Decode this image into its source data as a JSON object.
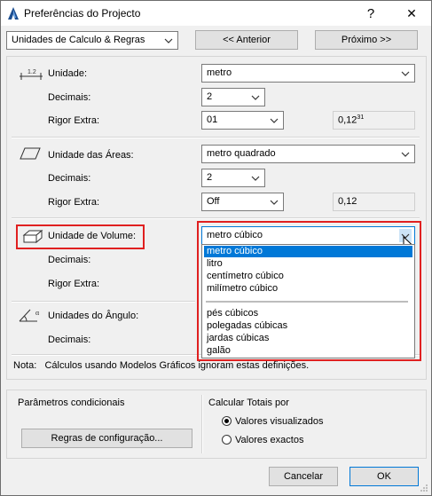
{
  "window": {
    "title": "Preferências do Projecto",
    "help_glyph": "?",
    "close_glyph": "✕"
  },
  "nav": {
    "section": "Unidades de Calculo & Regras",
    "previous": "<< Anterior",
    "next": "Próximo >>"
  },
  "length": {
    "icon_text": "1.2",
    "unit_label": "Unidade:",
    "unit_value": "metro",
    "decimals_label": "Decimais:",
    "decimals_value": "2",
    "extra_label": "Rigor Extra:",
    "extra_value": "01",
    "preview": "0,12",
    "preview_sup": "31"
  },
  "area": {
    "unit_label": "Unidade das Áreas:",
    "unit_value": "metro quadrado",
    "decimals_label": "Decimais:",
    "decimals_value": "2",
    "extra_label": "Rigor Extra:",
    "extra_value": "Off",
    "preview": "0,12"
  },
  "volume": {
    "unit_label": "Unidade de Volume:",
    "unit_value": "metro cúbico",
    "decimals_label": "Decimais:",
    "extra_label": "Rigor Extra:",
    "options": [
      "metro cúbico",
      "litro",
      "centímetro cúbico",
      "milímetro cúbico",
      "pés cúbicos",
      "polegadas cúbicas",
      "jardas cúbicas",
      "galão"
    ],
    "selected_index": 0
  },
  "angle": {
    "icon_text": "α",
    "unit_label": "Unidades do Ângulo:",
    "decimals_label": "Decimais:"
  },
  "note": "Nota:   Cálculos usando Modelos Gráficos ignoram estas definições.",
  "conditional": {
    "title": "Parâmetros condicionais",
    "rules_button": "Regras de configuração..."
  },
  "totals": {
    "title": "Calcular Totais por",
    "options": [
      "Valores visualizados",
      "Valores exactos"
    ],
    "selected_index": 0
  },
  "footer": {
    "cancel": "Cancelar",
    "ok": "OK"
  },
  "colors": {
    "highlight": "#0078d7",
    "annotation": "#e02020"
  }
}
